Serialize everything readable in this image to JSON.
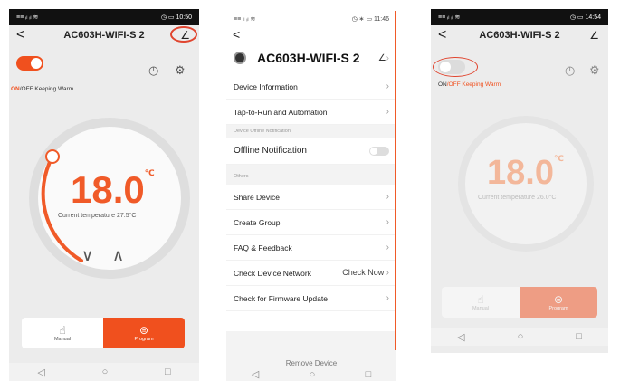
{
  "screen1": {
    "status_left": "≡≡ ᵢₗ ᵢₗ ≋",
    "status_right": "◷ ▭ 10:50",
    "title": "AC603H-WIFI-S 2",
    "back_glyph": "<",
    "edit_glyph": "∠",
    "on_label": "ON",
    "off_label": "/OFF Keeping Warm",
    "temp_value": "18.0",
    "temp_unit": "℃",
    "current_temp": "Current temperature 27.5°C",
    "mode_manual": "Manual",
    "mode_program": "Program",
    "down_glyph": "∨",
    "up_glyph": "∧",
    "accent": "#f0501e"
  },
  "screen2": {
    "status_left": "≡≡ ᵢₗ ᵢₗ ≋",
    "status_right": "◷ ∗ ▭ 11:46",
    "back_glyph": "<",
    "device_name": "AC603H-WIFI-S 2",
    "edit_glyph": "∠",
    "items_top": [
      {
        "label": "Device Information"
      },
      {
        "label": "Tap-to-Run and Automation"
      }
    ],
    "section_offline": "Device Offline Notification",
    "offline_label": "Offline Notification",
    "section_others": "Others",
    "items_others": [
      {
        "label": "Share Device",
        "value": ""
      },
      {
        "label": "Create Group",
        "value": ""
      },
      {
        "label": "FAQ & Feedback",
        "value": ""
      },
      {
        "label": "Check Device Network",
        "value": "Check Now"
      },
      {
        "label": "Check for Firmware Update",
        "value": ""
      }
    ],
    "remove_label": "Remove Device"
  },
  "screen3": {
    "status_left": "≡≡ ᵢₗ ᵢₗ ≋",
    "status_right": "◷ ▭ 14:54",
    "title": "AC603H-WIFI-S 2",
    "back_glyph": "<",
    "edit_glyph": "∠",
    "on_label": "ON",
    "off_label": "/OFF Keeping Warm",
    "temp_value": "18.0",
    "temp_unit": "℃",
    "current_temp": "Current temperature 26.0°C",
    "mode_manual": "Manual",
    "mode_program": "Program"
  }
}
